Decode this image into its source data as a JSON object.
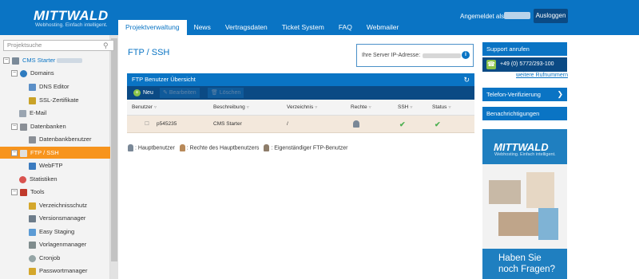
{
  "header": {
    "logo": "MITTWALD",
    "tagline": "Webhosting. Einfach intelligent.",
    "login_label": "Angemeldet als:",
    "logout_label": "Ausloggen"
  },
  "nav": {
    "items": [
      "Projektverwaltung",
      "News",
      "Vertragsdaten",
      "Ticket System",
      "FAQ",
      "Webmailer"
    ],
    "active": "Projektverwaltung"
  },
  "sidebar": {
    "search_placeholder": "Projektsuche",
    "items": [
      {
        "label": "CMS Starter",
        "level": 0,
        "toggle": "⊖"
      },
      {
        "label": "Domains",
        "level": 1,
        "toggle": "⊖"
      },
      {
        "label": "DNS Editor",
        "level": 2
      },
      {
        "label": "SSL-Zertifikate",
        "level": 2
      },
      {
        "label": "E-Mail",
        "level": 1
      },
      {
        "label": "Datenbanken",
        "level": 1,
        "toggle": "⊖"
      },
      {
        "label": "Datenbankbenutzer",
        "level": 2
      },
      {
        "label": "FTP / SSH",
        "level": 1,
        "toggle": "⊖",
        "active": true
      },
      {
        "label": "WebFTP",
        "level": 2
      },
      {
        "label": "Statistiken",
        "level": 1
      },
      {
        "label": "Tools",
        "level": 1,
        "toggle": "⊖"
      },
      {
        "label": "Verzeichnisschutz",
        "level": 2
      },
      {
        "label": "Versionsmanager",
        "level": 2
      },
      {
        "label": "Easy Staging",
        "level": 2
      },
      {
        "label": "Vorlagenmanager",
        "level": 2
      },
      {
        "label": "Cronjob",
        "level": 2
      },
      {
        "label": "Passwortmanager",
        "level": 2
      }
    ]
  },
  "main": {
    "title": "FTP / SSH",
    "ip_label": "Ihre Server IP-Adresse:",
    "panel_title": "FTP Benutzer Übersicht",
    "toolbar": {
      "new": "Neu",
      "edit": "Bearbeiten",
      "delete": "Löschen"
    },
    "columns": [
      "Benutzer",
      "Beschreibung",
      "Verzeichnis",
      "Rechte",
      "SSH",
      "Status"
    ],
    "rows": [
      {
        "user": "p545235",
        "description": "CMS Starter",
        "directory": "/",
        "ssh": "✔",
        "status": "✔"
      }
    ],
    "legend": [
      ": Hauptbenutzer",
      ": Rechte des Hauptbenutzers",
      ": Eigenständiger FTP-Benutzer"
    ]
  },
  "right": {
    "support_call": "Support anrufen",
    "phone": "+49 (0) 5772/293-100",
    "more_numbers": "weitere Rufnummern",
    "phone_verify": "Telefon-Verifizierung",
    "notifications": "Benachrichtigungen",
    "ad_logo": "MITTWALD",
    "ad_tagline": "Webhosting. Einfach intelligent.",
    "ad_headline_1": "Haben Sie",
    "ad_headline_2": "noch Fragen?"
  }
}
